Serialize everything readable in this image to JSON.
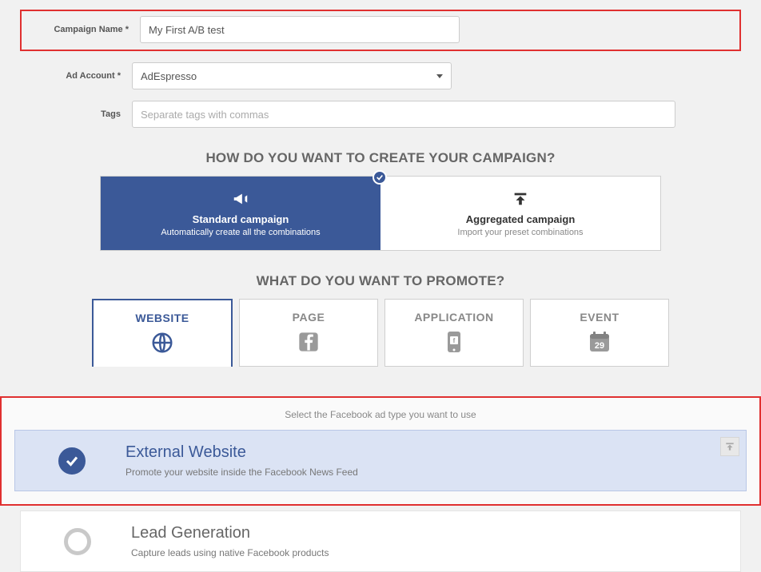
{
  "form": {
    "campaign_name_label": "Campaign Name *",
    "campaign_name_value": "My First A/B test",
    "ad_account_label": "Ad Account *",
    "ad_account_value": "AdEspresso",
    "tags_label": "Tags",
    "tags_placeholder": "Separate tags with commas"
  },
  "headings": {
    "create_campaign": "HOW DO YOU WANT TO CREATE YOUR CAMPAIGN?",
    "promote": "WHAT DO YOU WANT TO PROMOTE?"
  },
  "campaign_types": {
    "standard": {
      "title": "Standard campaign",
      "subtitle": "Automatically create all the combinations"
    },
    "aggregated": {
      "title": "Aggregated campaign",
      "subtitle": "Import your preset combinations"
    }
  },
  "promote_tabs": {
    "website": "WEBSITE",
    "page": "PAGE",
    "application": "APPLICATION",
    "event": "EVENT",
    "event_day": "29"
  },
  "adtype": {
    "hint": "Select the Facebook ad type you want to use",
    "external": {
      "title": "External Website",
      "desc": "Promote your website inside the Facebook News Feed"
    },
    "leadgen": {
      "title": "Lead Generation",
      "desc": "Capture leads using native Facebook products"
    }
  },
  "icons": {
    "check": "check-icon",
    "megaphone": "megaphone-icon",
    "upload": "upload-icon",
    "globe": "globe-icon",
    "facebook": "facebook-icon",
    "mobile": "mobile-app-icon",
    "calendar": "calendar-icon"
  }
}
